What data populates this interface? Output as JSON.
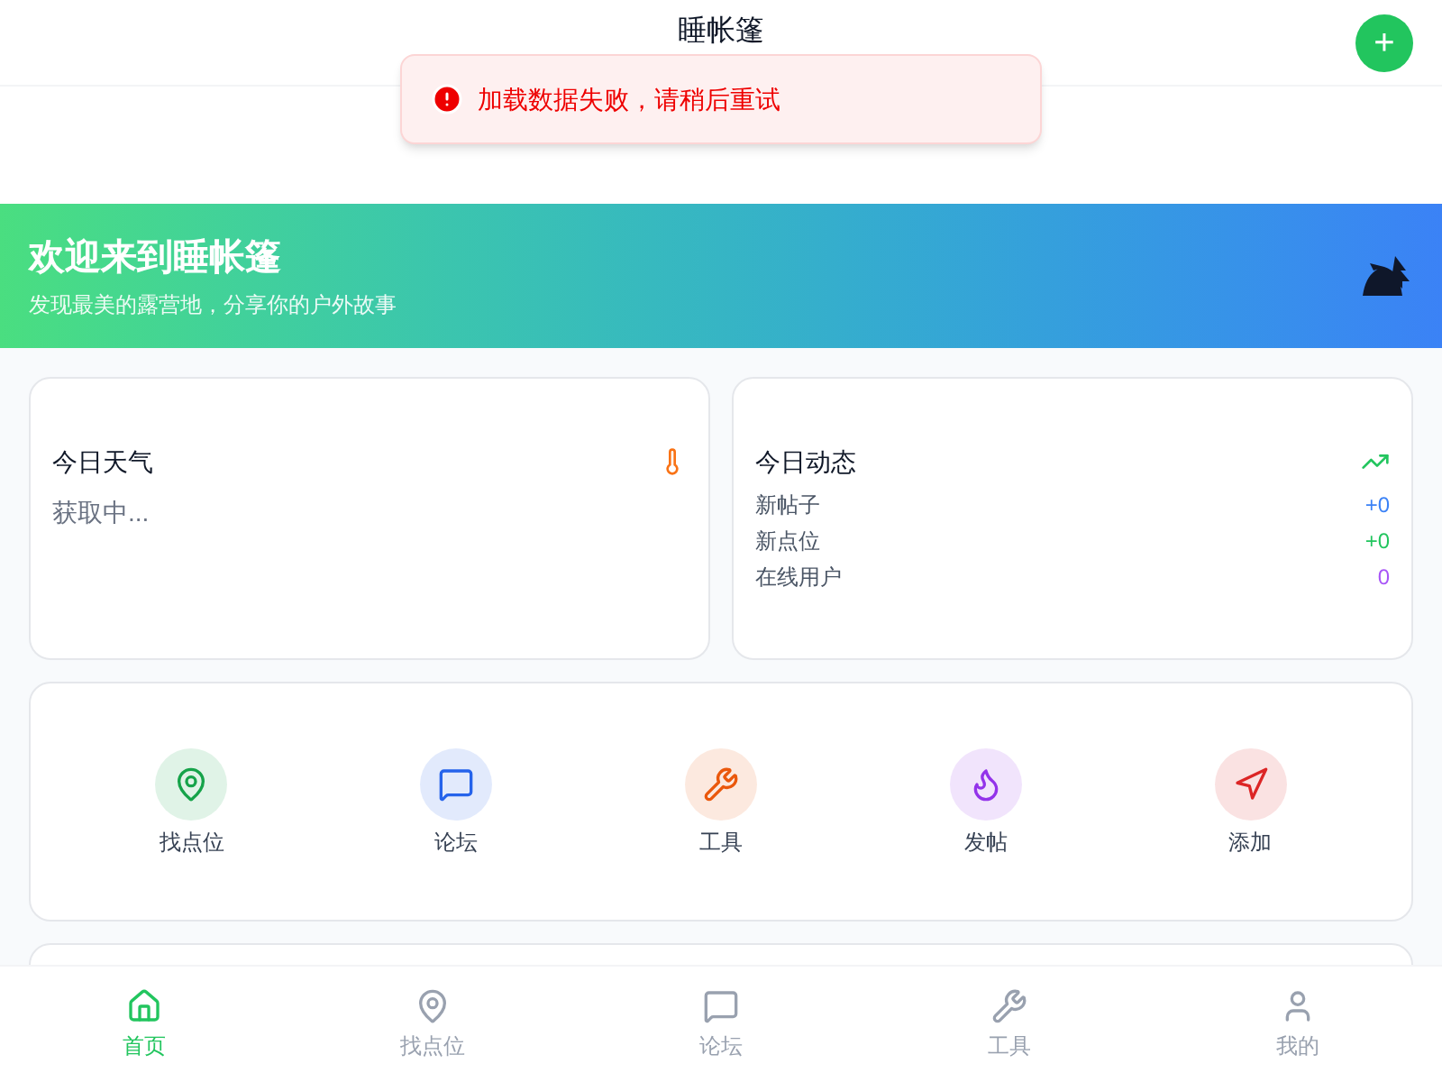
{
  "header": {
    "title": "睡帐篷",
    "add_button": "+"
  },
  "toast": {
    "text": "加载数据失败，请稍后重试"
  },
  "banner": {
    "title": "欢迎来到睡帐篷",
    "subtitle": "发现最美的露营地，分享你的户外故事"
  },
  "weather": {
    "title": "今日天气",
    "status": "获取中..."
  },
  "activity": {
    "title": "今日动态",
    "stats": [
      {
        "label": "新帖子",
        "value": "+0",
        "color": "#3b82f6"
      },
      {
        "label": "新点位",
        "value": "+0",
        "color": "#22c55e"
      },
      {
        "label": "在线用户",
        "value": "0",
        "color": "#a855f7"
      }
    ]
  },
  "quick_actions": [
    {
      "label": "找点位",
      "kind": "pin",
      "color": "#16a34a"
    },
    {
      "label": "论坛",
      "kind": "chat",
      "color": "#2563eb"
    },
    {
      "label": "工具",
      "kind": "wrench",
      "color": "#ea580c"
    },
    {
      "label": "发帖",
      "kind": "flame",
      "color": "#9333ea"
    },
    {
      "label": "添加",
      "kind": "send",
      "color": "#dc2626"
    }
  ],
  "bottom_nav": [
    {
      "label": "首页",
      "kind": "home",
      "selected": true
    },
    {
      "label": "找点位",
      "kind": "pin",
      "selected": false
    },
    {
      "label": "论坛",
      "kind": "chat",
      "selected": false
    },
    {
      "label": "工具",
      "kind": "wrench",
      "selected": false
    },
    {
      "label": "我的",
      "kind": "user",
      "selected": false
    }
  ]
}
